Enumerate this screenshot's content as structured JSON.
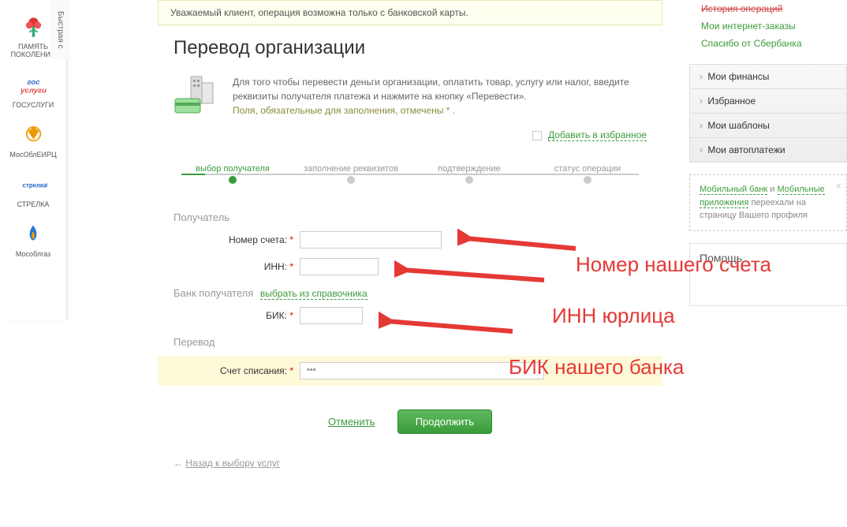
{
  "leftSidebar": {
    "tabLabel": "Быстрая с",
    "items": [
      {
        "label": "ПАМЯТЬ\nПОКОЛЕНИЙ"
      },
      {
        "label": "ГОСУСЛУГИ"
      },
      {
        "label": "МосОблЕИРЦ"
      },
      {
        "label": "СТРЕЛКА"
      },
      {
        "label": "Мособлгаз"
      }
    ]
  },
  "alert": "Уважаемый клиент, операция возможна только с банковской карты.",
  "pageTitle": "Перевод организации",
  "infoText": {
    "line1": "Для того чтобы перевести деньги организации, оплатить товар, услугу или налог, введите реквизиты получателя платежа и нажмите на кнопку «Перевести».",
    "line2": "Поля, обязательные для заполнения, отмечены ",
    "mark": "*",
    "line2end": " ."
  },
  "favoritesLink": "Добавить в избранное",
  "progress": {
    "step1": "выбор получателя",
    "step2": "заполнение реквизитов",
    "step3": "подтверждение",
    "step4": "статус операции"
  },
  "form": {
    "recipientLabel": "Получатель",
    "accountLabel": "Номер счета:",
    "innLabel": "ИНН:",
    "bankLabel": "Банк получателя",
    "bankDirectoryLink": "выбрать из справочника",
    "bikLabel": "БИК:",
    "transferLabel": "Перевод",
    "debitLabel": "Счет списания:",
    "debitValue": "•••"
  },
  "buttons": {
    "cancel": "Отменить",
    "submit": "Продолжить"
  },
  "backLink": "Назад к выбору услуг",
  "rightSidebar": {
    "topStrike": "История операций",
    "topLinks": [
      "Мои интернет-заказы",
      "Спасибо от Сбербанка"
    ],
    "menu": [
      "Мои финансы",
      "Избранное",
      "Мои шаблоны",
      "Мои автоплатежи"
    ],
    "infoBox": {
      "link1": "Мобильный банк",
      "and": " и ",
      "link2": "Мобильные приложения",
      "rest": " переехали на страницу Вашего профиля"
    },
    "helpTitle": "Помощь"
  },
  "annotations": {
    "account": "Номер  нашего счета",
    "inn": "ИНН юрлица",
    "bik": "БИК нашего банка"
  }
}
